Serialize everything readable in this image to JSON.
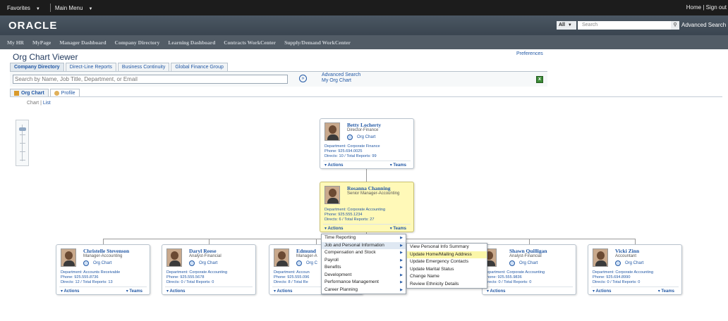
{
  "topbar": {
    "favorites": "Favorites",
    "main_menu": "Main Menu",
    "right": "Home | Sign out"
  },
  "header": {
    "logo": "ORACLE",
    "search_scope": "All",
    "search_placeholder": "Search",
    "advanced_search": "Advanced Search"
  },
  "nav": [
    "My HR",
    "MyPage",
    "Manager Dashboard",
    "Company Directory",
    "Learning Dashboard",
    "Contracts WorkCenter",
    "Supply/Demand WorkCenter"
  ],
  "page": {
    "title": "Org Chart Viewer",
    "preferences": "Preferences",
    "tabs": [
      "Company Directory",
      "Direct-Line Reports",
      "Business Continuity",
      "Global Finance Group"
    ],
    "search_placeholder": "Search by Name, Job Title, Department, or Email",
    "advanced_search": "Advanced Search",
    "my_org_chart": "My Org Chart",
    "subtabs": [
      "Org Chart",
      "Profile"
    ],
    "chart_label": "Chart",
    "list_label": "List"
  },
  "cards": {
    "top": {
      "name": "Betty Locherty",
      "title": "Director-Finance",
      "org": "Org Chart",
      "dept": "Department: Corporate Finance",
      "phone": "Phone: 925.694.0025",
      "directs": "Directs: 10 / Total Reports: 99",
      "actions": "Actions",
      "teams": "Teams"
    },
    "mid": {
      "name": "Rosanna Channing",
      "title": "Senior Manager-Accounting",
      "org": "Org Chart",
      "dept": "Department: Corporate Accounting",
      "phone": "Phone: 925.555.1234",
      "directs": "Directs: 6 / Total Reports: 27",
      "actions": "Actions",
      "teams": "Teams"
    },
    "c1": {
      "name": "Christelle Stevenson",
      "title": "Manager-Accounting",
      "org": "Org Chart",
      "dept": "Department: Accounts Receivable",
      "phone": "Phone: 925.555.8736",
      "directs": "Directs: 12 / Total Reports: 13",
      "actions": "Actions",
      "teams": "Teams"
    },
    "c2": {
      "name": "Daryl Reese",
      "title": "Analyst-Financial",
      "org": "Org Chart",
      "dept": "Department: Corporate Accounting",
      "phone": "Phone: 925.555.5678",
      "directs": "Directs: 0 / Total Reports: 0",
      "actions": "Actions"
    },
    "c3": {
      "name": "Edmund",
      "title": "Manager-A",
      "org": "Org C",
      "dept": "Department: Accoun",
      "phone": "Phone: 925.555.096",
      "directs": "Directs: 8 / Total Re",
      "actions": "Actions"
    },
    "c5": {
      "name": "Shawn Quilligan",
      "title": "Analyst-Financial",
      "org": "Org Chart",
      "dept": "epartment: Corporate Accounting",
      "phone": "hone: 925.555.9836",
      "directs": "irects: 0 / Total Reports: 0",
      "actions": "Actions"
    },
    "c6": {
      "name": "Vicki Zinn",
      "title": "Accountant",
      "org": "Org Chart",
      "dept": "Department: Corporate Accounting",
      "phone": "Phone: 925.694.8990",
      "directs": "Directs: 0 / Total Reports: 0",
      "actions": "Actions",
      "teams": "Teams"
    }
  },
  "menu1": [
    "Time Reporting",
    "Job and Personal Information",
    "Compensation and Stock",
    "Payroll",
    "Benefits",
    "Development",
    "Performance Management",
    "Career Planning"
  ],
  "menu2": [
    "View Personal Info Summary",
    "Update Home/Mailing Address",
    "Update Emergency Contacts",
    "Update Marital Status",
    "Change Name",
    "Review Ethnicity Details"
  ]
}
